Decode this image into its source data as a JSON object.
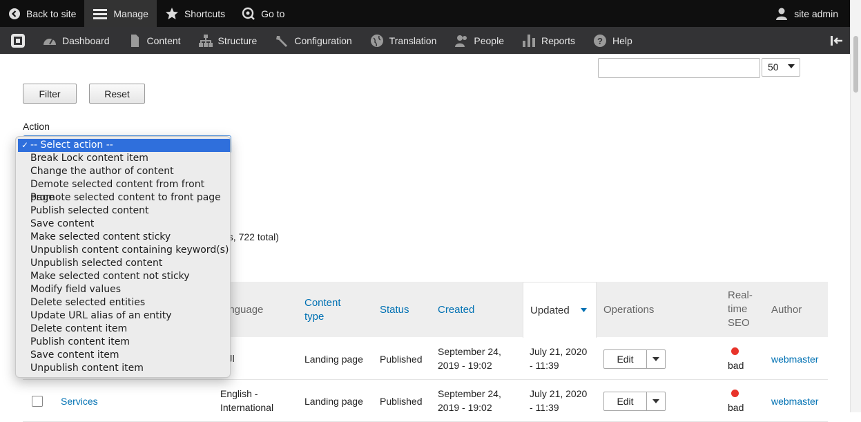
{
  "toolbar": {
    "back": "Back to site",
    "manage": "Manage",
    "shortcuts": "Shortcuts",
    "goto": "Go to",
    "user": "site admin"
  },
  "tray": {
    "items": [
      "Dashboard",
      "Content",
      "Structure",
      "Configuration",
      "Translation",
      "People",
      "Reports",
      "Help"
    ]
  },
  "filters": {
    "search_value": "",
    "items_per_page": "50",
    "filter_label": "Filter",
    "reset_label": "Reset"
  },
  "action": {
    "label": "Action",
    "options": [
      "-- Select action --",
      "Break Lock content item",
      "Change the author of content",
      "Demote selected content from front page",
      "Promote selected content to front page",
      "Publish selected content",
      "Save content",
      "Make selected content sticky",
      "Unpublish content containing keyword(s)",
      "Unpublish selected content",
      "Make selected content not sticky",
      "Modify field values",
      "Delete selected entities",
      "Update URL alias of an entity",
      "Delete content item",
      "Publish content item",
      "Save content item",
      "Unpublish content item"
    ],
    "selected_index": 0,
    "check": "✓"
  },
  "summary_text": "es, 722 total)",
  "table": {
    "headers": {
      "language": "anguage",
      "content_type_1": "Content",
      "content_type_2": "type",
      "status": "Status",
      "created": "Created",
      "updated": "Updated",
      "operations": "Operations",
      "seo_1": "Real-",
      "seo_2": "time",
      "seo_3": "SEO",
      "author": "Author"
    },
    "rows": [
      {
        "title": "",
        "language_1": "العر",
        "language_2": "",
        "content_type": "Landing page",
        "status": "Published",
        "created_1": "September 24,",
        "created_2": "2019 - 19:02",
        "updated_1": "July 21, 2020",
        "updated_2": "- 11:39",
        "op": "Edit",
        "seo": "bad",
        "author": "webmaster"
      },
      {
        "title": "Services",
        "language_1": "English -",
        "language_2": "International",
        "content_type": "Landing page",
        "status": "Published",
        "created_1": "September 24,",
        "created_2": "2019 - 19:02",
        "updated_1": "July 21, 2020",
        "updated_2": "- 11:39",
        "op": "Edit",
        "seo": "bad",
        "author": "webmaster"
      }
    ]
  },
  "colors": {
    "link": "#0071b3",
    "seo_bad": "#e8332a",
    "selected_option": "#2f6fdc"
  }
}
